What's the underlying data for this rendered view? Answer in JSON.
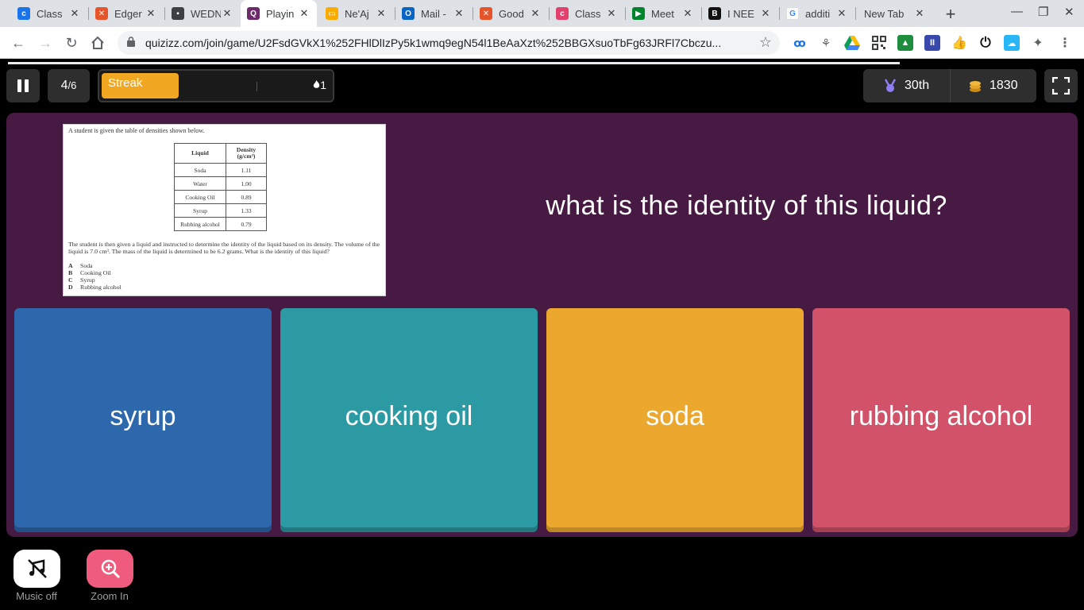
{
  "browser": {
    "tabs": [
      {
        "title": "Class",
        "favicon": "classroom-icon",
        "color": "#1a73e8"
      },
      {
        "title": "Edger",
        "favicon": "edgenuity-icon",
        "color": "#e8542a"
      },
      {
        "title": "WEDN",
        "favicon": "contact-card-icon",
        "color": "#3c4043"
      },
      {
        "title": "Playin",
        "favicon": "quizizz-icon",
        "color": "#6c2a6a"
      },
      {
        "title": "Ne'Aj",
        "favicon": "slides-icon",
        "color": "#f9ab00"
      },
      {
        "title": "Mail -",
        "favicon": "outlook-icon",
        "color": "#0a64c4"
      },
      {
        "title": "Good",
        "favicon": "edgenuity-icon",
        "color": "#e8542a"
      },
      {
        "title": "Class",
        "favicon": "classroom-icon",
        "color": "#e3416d"
      },
      {
        "title": "Meet",
        "favicon": "meet-icon",
        "color": "#00832d"
      },
      {
        "title": "I NEE",
        "favicon": "brainly-icon",
        "color": "#111111"
      },
      {
        "title": "additi",
        "favicon": "google-icon",
        "color": "#4285f4"
      },
      {
        "title": "New Tab",
        "favicon": "",
        "color": ""
      }
    ],
    "active_tab": 3,
    "url": "quizizz.com/join/game/U2FsdGVkX1%252FHlDlIzPy5k1wmq9egN54l1BeAaXzt%252BBGXsuoTbFg63JRFl7Cbczu..."
  },
  "game": {
    "question_index": "4",
    "question_total": "/6",
    "streak_label": "Streak",
    "streak_count": "1",
    "rank": "30th",
    "points": "1830",
    "question_text": "what is the identity of this liquid?",
    "image": {
      "intro": "A student is given the table of densities shown below.",
      "table_headers": [
        "Liquid",
        "Density (g/cm³)"
      ],
      "table_rows": [
        [
          "Soda",
          "1.11"
        ],
        [
          "Water",
          "1.00"
        ],
        [
          "Cooking Oil",
          "0.89"
        ],
        [
          "Syrup",
          "1.33"
        ],
        [
          "Rubbing alcohol",
          "0.79"
        ]
      ],
      "body": "The student is then given a liquid and instructed to determine the identity of the liquid based on its density.  The volume of the liquid is 7.0 cm³.  The mass of the liquid is determined to be 6.2 grams. What is the identity of this liquid?",
      "options": [
        {
          "letter": "A",
          "text": "Soda"
        },
        {
          "letter": "B",
          "text": "Cooking Oil"
        },
        {
          "letter": "C",
          "text": "Syrup"
        },
        {
          "letter": "D",
          "text": "Rubbing alcohol"
        }
      ]
    },
    "answers": [
      {
        "label": "syrup",
        "color": "#2d67ac"
      },
      {
        "label": "cooking oil",
        "color": "#2b9aa3"
      },
      {
        "label": "soda",
        "color": "#eba72e"
      },
      {
        "label": "rubbing alcohol",
        "color": "#d25369"
      }
    ],
    "music_label": "Music off",
    "zoom_label": "Zoom In"
  }
}
